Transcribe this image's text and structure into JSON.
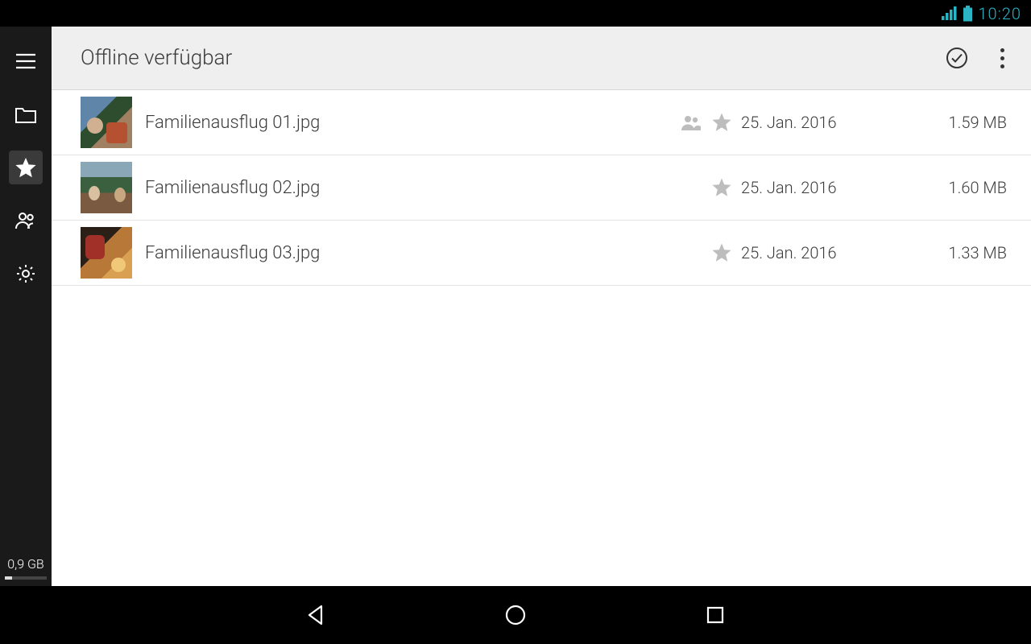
{
  "status": {
    "time": "10:20"
  },
  "sidebar": {
    "storage_label": "0,9 GB",
    "storage_fill_pct": 18
  },
  "toolbar": {
    "title": "Offline verfügbar"
  },
  "files": [
    {
      "name": "Familienausflug 01.jpg",
      "date": "25. Jan. 2016",
      "size": "1.59 MB",
      "shared": true,
      "thumb": "t1"
    },
    {
      "name": "Familienausflug 02.jpg",
      "date": "25. Jan. 2016",
      "size": "1.60 MB",
      "shared": false,
      "thumb": "t2"
    },
    {
      "name": "Familienausflug 03.jpg",
      "date": "25. Jan. 2016",
      "size": "1.33 MB",
      "shared": false,
      "thumb": "t3"
    }
  ]
}
